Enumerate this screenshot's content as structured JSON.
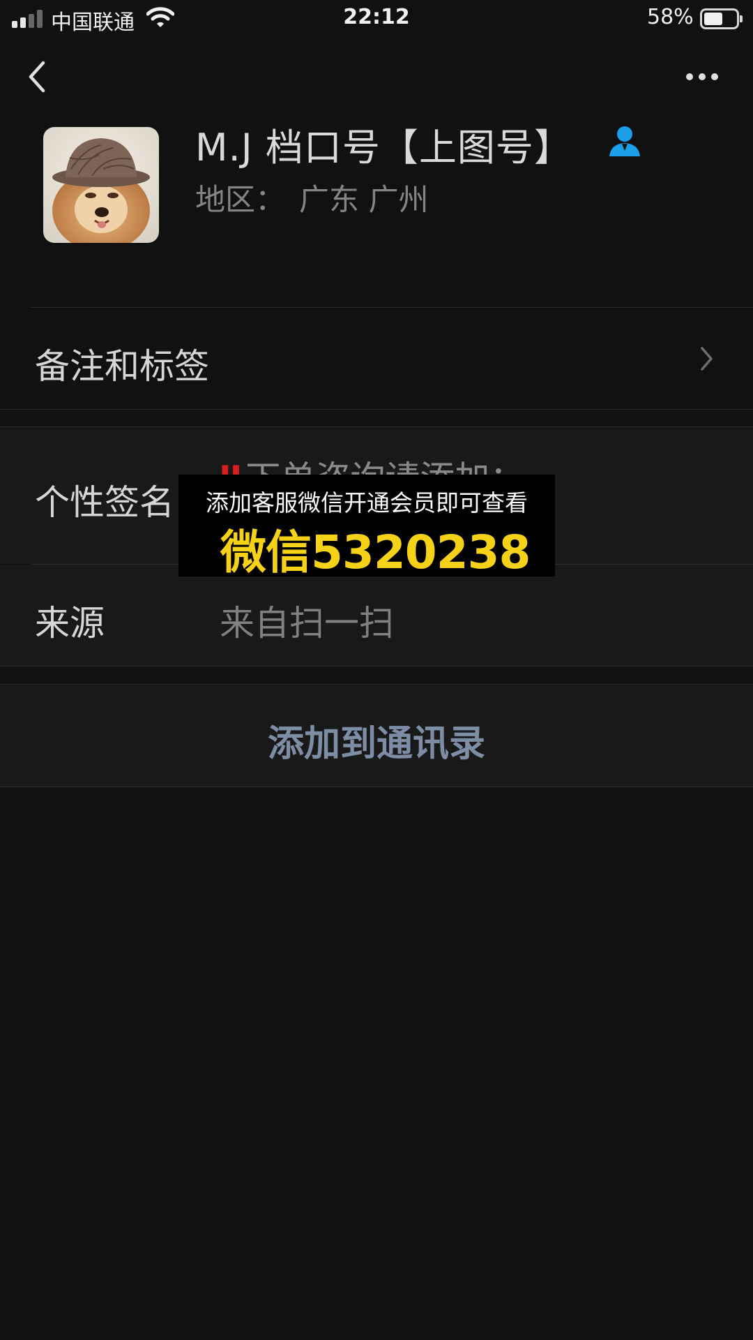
{
  "status_bar": {
    "carrier": "中国联通",
    "time": "22:12",
    "battery_percent": "58%",
    "battery_level": 0.58,
    "signal_bars_active": 2,
    "signal_bars_total": 4
  },
  "nav": {
    "back_icon": "chevron-left-icon",
    "more_icon": "more-horizontal-icon"
  },
  "profile": {
    "name": "M.J 档口号【上图号】",
    "contact_badge_icon": "person-icon",
    "contact_badge_color": "#1a9fe8",
    "region_label": "地区：",
    "region_value": "广东 广州"
  },
  "cells": {
    "remarks_label": "备注和标签",
    "signature_label": "个性签名",
    "signature_mark": "‼",
    "signature_value": "下单咨询请添加：",
    "source_label": "来源",
    "source_value": "来自扫一扫"
  },
  "actions": {
    "add_contact_label": "添加到通讯录",
    "add_contact_color": "#7d8da6"
  },
  "promo": {
    "line1": "添加客服微信开通会员即可查看",
    "line2": "微信5320238",
    "highlight_color": "#f5d218"
  }
}
